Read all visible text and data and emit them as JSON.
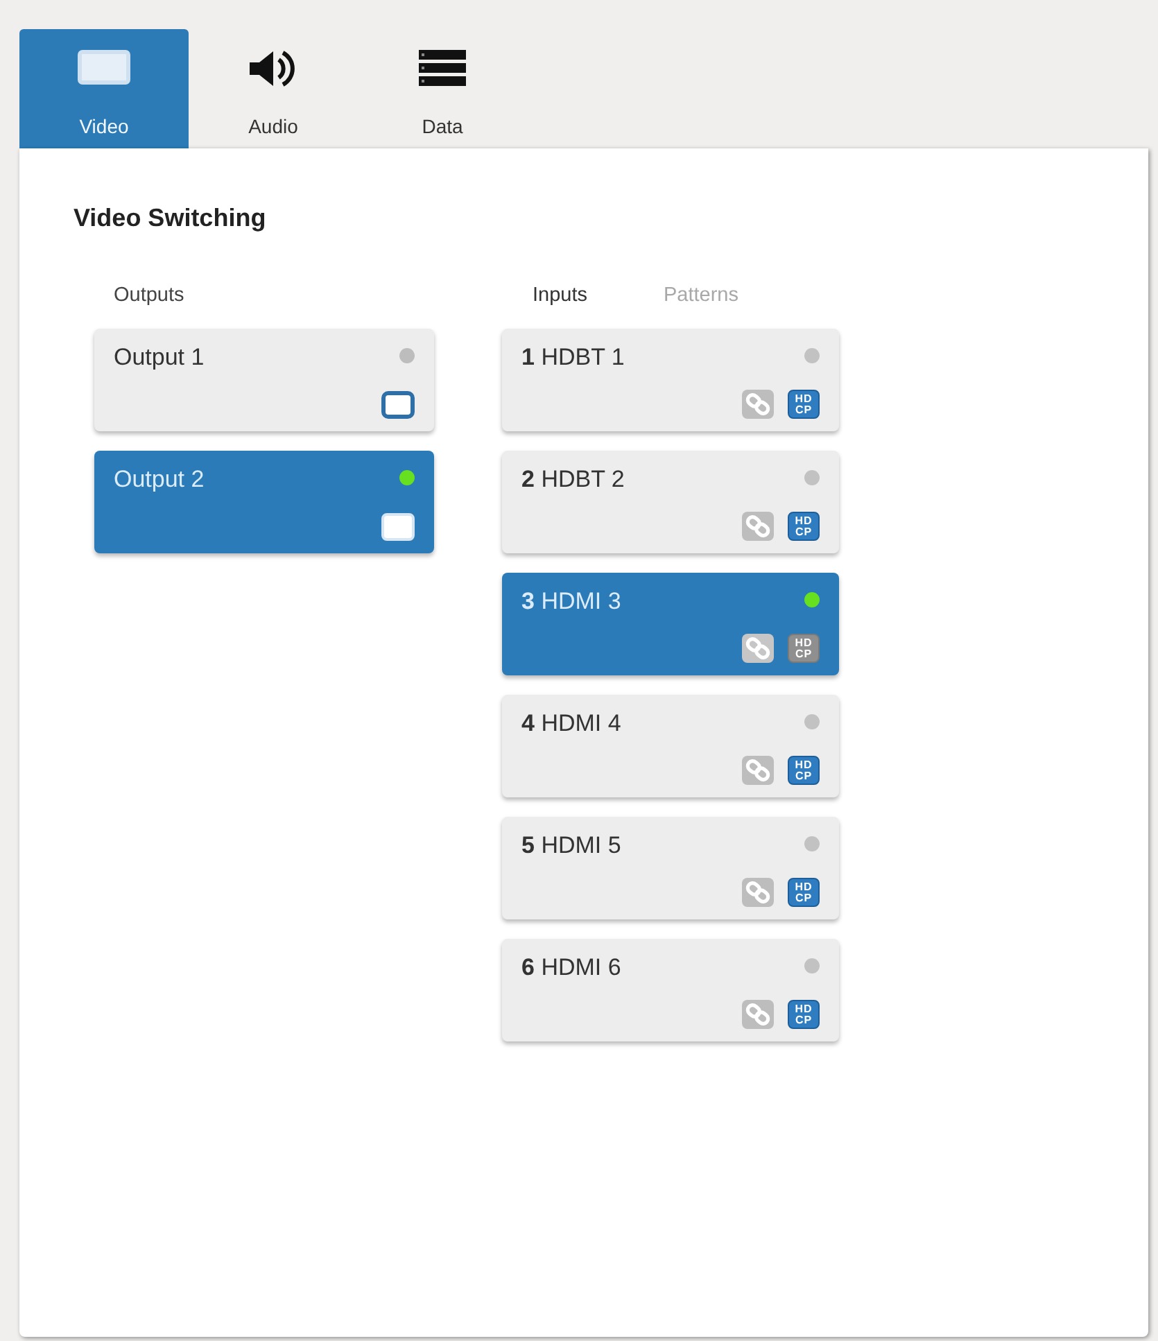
{
  "tabs": [
    {
      "kind": "video",
      "label": "Video",
      "selected": true
    },
    {
      "kind": "audio",
      "label": "Audio",
      "selected": false
    },
    {
      "kind": "data",
      "label": "Data",
      "selected": false
    }
  ],
  "panel": {
    "title": "Video Switching",
    "outputs": {
      "heading": "Outputs",
      "items": [
        {
          "label": "Output 1",
          "selected": false,
          "color": "#bdbdbd"
        },
        {
          "label": "Output 2",
          "selected": true,
          "color": "#66e01f"
        }
      ]
    },
    "inputs": {
      "tabs": [
        {
          "label": "Inputs",
          "selected": true
        },
        {
          "label": "Patterns",
          "selected": false
        }
      ],
      "items": [
        {
          "number": "1",
          "name": "HDBT 1",
          "selected": false,
          "color": "#c2c2c2",
          "badge": [
            "HD",
            "CP"
          ]
        },
        {
          "number": "2",
          "name": "HDBT 2",
          "selected": false,
          "color": "#c2c2c2",
          "badge": [
            "HD",
            "CP"
          ]
        },
        {
          "number": "3",
          "name": "HDMI 3",
          "selected": true,
          "color": "#66e01f",
          "badge": [
            "HD",
            "CP"
          ]
        },
        {
          "number": "4",
          "name": "HDMI 4",
          "selected": false,
          "color": "#c2c2c2",
          "badge": [
            "HD",
            "CP"
          ]
        },
        {
          "number": "5",
          "name": "HDMI 5",
          "selected": false,
          "color": "#c2c2c2",
          "badge": [
            "HD",
            "CP"
          ]
        },
        {
          "number": "6",
          "name": "HDMI 6",
          "selected": false,
          "color": "#c2c2c2",
          "badge": [
            "HD",
            "CP"
          ]
        }
      ]
    }
  }
}
